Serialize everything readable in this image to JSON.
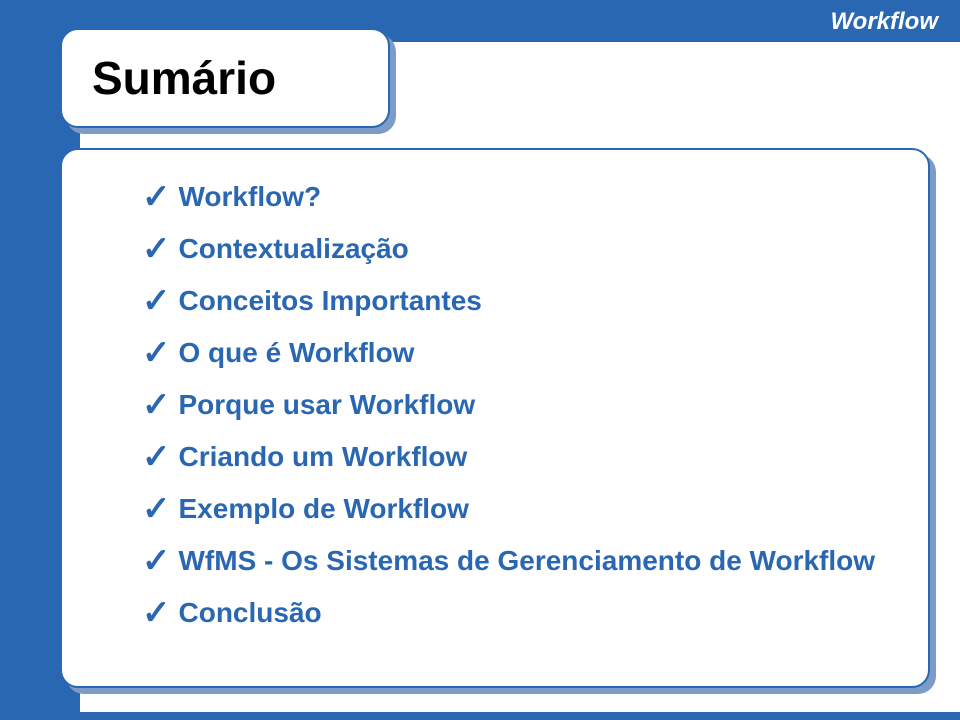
{
  "header": {
    "tag": "Workflow"
  },
  "title": "Sumário",
  "items": [
    "Workflow?",
    "Contextualização",
    "Conceitos Importantes",
    "O que é Workflow",
    "Porque usar Workflow",
    "Criando um Workflow",
    "Exemplo de Workflow",
    "WfMS - Os Sistemas de Gerenciamento de Workflow",
    "Conclusão"
  ]
}
